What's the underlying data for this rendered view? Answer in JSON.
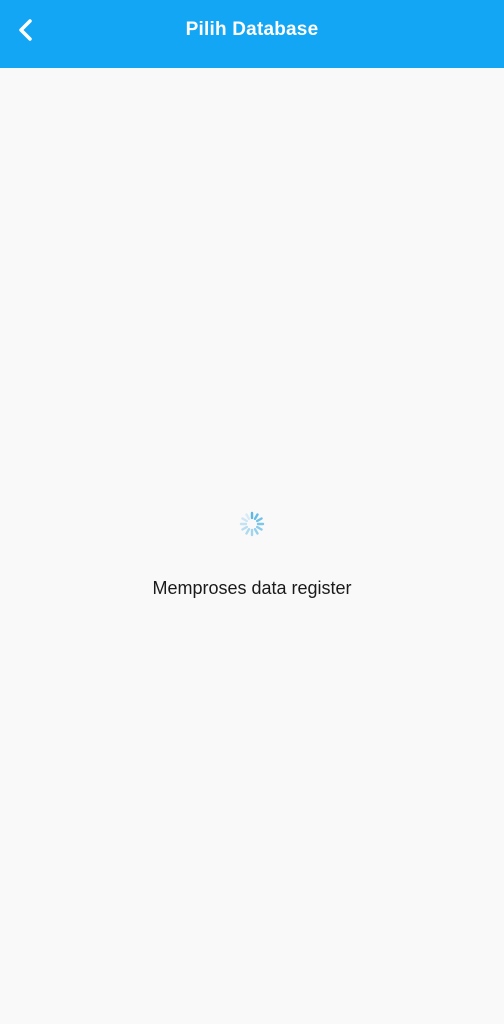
{
  "header": {
    "title": "Pilih Database",
    "back_icon": "chevron-left-icon",
    "background_color": "#12a6f5"
  },
  "loading": {
    "spinner_icon": "loading-spinner-icon",
    "spinner_color": "#5bb8e6",
    "message": "Memproses data register"
  }
}
